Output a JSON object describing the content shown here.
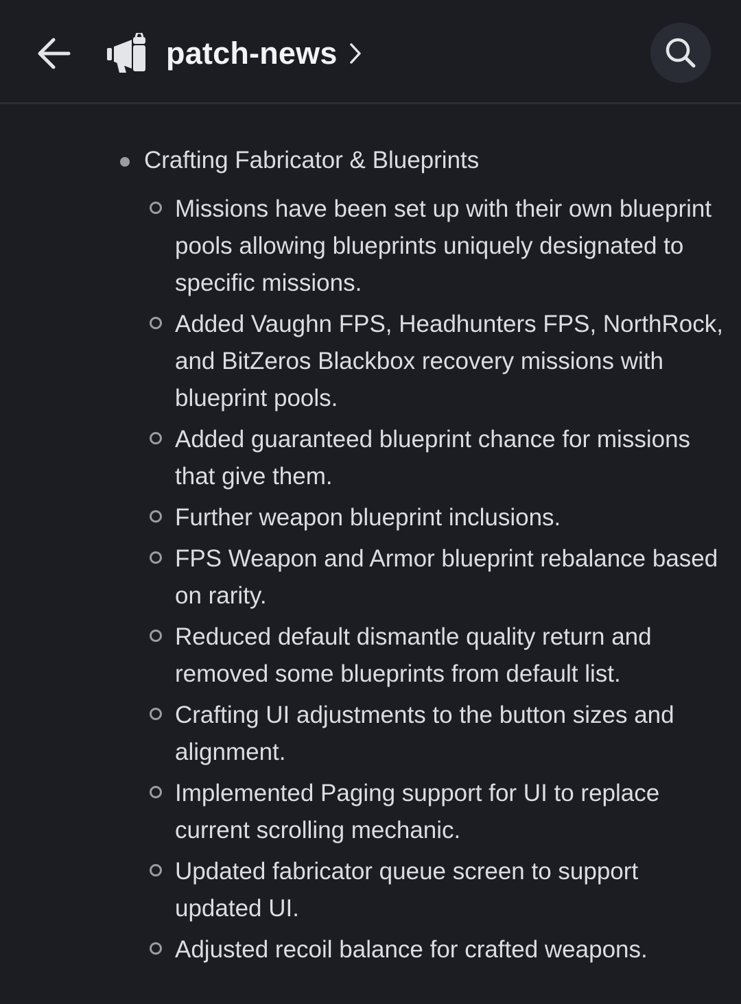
{
  "header": {
    "channel_name": "patch-news"
  },
  "content": {
    "section_title": "Crafting Fabricator & Blueprints",
    "items": [
      "Missions have been set up with their own blueprint pools allowing blueprints uniquely designated to specific missions.",
      "Added Vaughn FPS, Headhunters FPS, NorthRock, and BitZeros Blackbox recovery missions with blueprint pools.",
      "Added guaranteed blueprint chance for missions that give them.",
      "Further weapon blueprint inclusions.",
      "FPS Weapon and Armor blueprint rebalance based on rarity.",
      "Reduced default dismantle quality return and removed some blueprints from default list.",
      "Crafting UI adjustments to the button sizes and alignment.",
      "Implemented Paging support for UI to replace current scrolling mechanic.",
      "Updated fabricator queue screen to support updated UI.",
      "Adjusted recoil balance for crafted weapons."
    ]
  },
  "icons": {
    "back": "arrow-left-icon",
    "channel": "announcement-megaphone-icon",
    "chevron": "chevron-right-icon",
    "search": "search-icon"
  },
  "colors": {
    "background": "#1c1d23",
    "text": "#dbdee1",
    "title": "#f2f3f5",
    "bullet": "#9a9ca3",
    "search_bg": "#2a2c35"
  }
}
